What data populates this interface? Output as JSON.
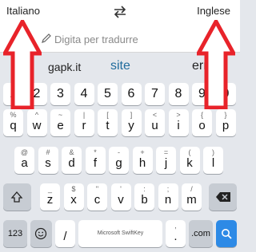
{
  "languages": {
    "source": "Italiano",
    "target": "Inglese",
    "swap_icon": "swap-arrows-icon"
  },
  "input": {
    "placeholder": "Digita per tradurre",
    "value": ""
  },
  "suggestions": [
    "gapk.it",
    "site",
    "erro"
  ],
  "keyboard": {
    "numbers": [
      "1",
      "2",
      "3",
      "4",
      "5",
      "6",
      "7",
      "8",
      "9",
      "0"
    ],
    "row1": [
      {
        "k": "q",
        "s": "%"
      },
      {
        "k": "w",
        "s": "^"
      },
      {
        "k": "e",
        "s": "~"
      },
      {
        "k": "r",
        "s": "|"
      },
      {
        "k": "t",
        "s": "["
      },
      {
        "k": "y",
        "s": "]"
      },
      {
        "k": "u",
        "s": "<"
      },
      {
        "k": "i",
        "s": ">"
      },
      {
        "k": "o",
        "s": "{"
      },
      {
        "k": "p",
        "s": "}"
      }
    ],
    "row2": [
      {
        "k": "a",
        "s": "@"
      },
      {
        "k": "s",
        "s": "#"
      },
      {
        "k": "d",
        "s": "&"
      },
      {
        "k": "f",
        "s": "*"
      },
      {
        "k": "g",
        "s": "-"
      },
      {
        "k": "h",
        "s": "+"
      },
      {
        "k": "j",
        "s": "="
      },
      {
        "k": "k",
        "s": "("
      },
      {
        "k": "l",
        "s": ")"
      }
    ],
    "row3": [
      {
        "k": "z",
        "s": "_"
      },
      {
        "k": "x",
        "s": "$"
      },
      {
        "k": "c",
        "s": "\""
      },
      {
        "k": "v",
        "s": "'"
      },
      {
        "k": "b",
        "s": ":"
      },
      {
        "k": "n",
        "s": ";"
      },
      {
        "k": "m",
        "s": "/"
      }
    ],
    "bottom": {
      "symbols_label": "123",
      "emoji_icon": "emoji-icon",
      "slash": "/",
      "space_label": "Microsoft SwiftKey",
      "period_sub": ",",
      "period": ".",
      "dotcom_label": ".com",
      "enter_icon": "search-icon"
    },
    "shift_icon": "shift-icon",
    "backspace_icon": "backspace-icon"
  },
  "colors": {
    "arrow": "#e8232a",
    "enter": "#2d8ae6",
    "accent_text": "#1f6b9c"
  }
}
